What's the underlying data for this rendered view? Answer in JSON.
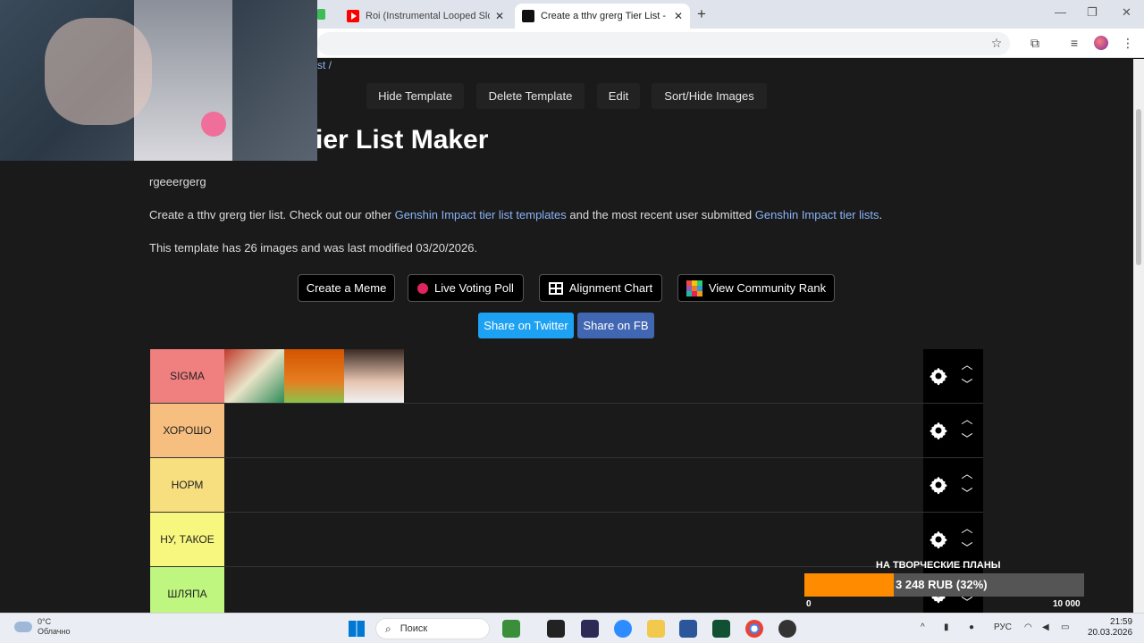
{
  "browser": {
    "tabs": [
      {
        "title": "Roi (Instrumental Looped Slowe",
        "active": false
      },
      {
        "title": "Create a tthv grerg Tier List - Ti",
        "active": true
      }
    ],
    "new_tab": "+",
    "window_controls": [
      "—",
      "❐",
      "✕"
    ]
  },
  "page": {
    "breadcrumb_tail": "st /",
    "top_buttons": [
      "Hide Template",
      "Delete Template",
      "Edit",
      "Sort/Hide Images"
    ],
    "title": "ier List Maker",
    "subtitle": "rgeeergerg",
    "description": {
      "part1": "Create a tthv grerg tier list. Check out our other ",
      "link1": "Genshin Impact tier list templates",
      "part2": " and the most recent user submitted ",
      "link2": "Genshin Impact tier lists",
      "part3": "."
    },
    "template_info": "This template has 26 images and was last modified 03/20/2026.",
    "action_buttons": [
      "Create a Meme",
      "Live Voting Poll",
      "Alignment Chart",
      "View Community Rank"
    ],
    "share_buttons": [
      "Share on Twitter",
      "Share on FB"
    ]
  },
  "tiers": [
    {
      "label": "SIGMA",
      "color": "#f07f7f",
      "items": 3
    },
    {
      "label": "ХОРОШО",
      "color": "#f6bf7f",
      "items": 0
    },
    {
      "label": "НОРМ",
      "color": "#f7df7f",
      "items": 0
    },
    {
      "label": "НУ, ТАКОЕ",
      "color": "#f7f67f",
      "items": 0
    },
    {
      "label": "ШЛЯПА",
      "color": "#bff67f",
      "items": 0
    }
  ],
  "donation": {
    "title": "НА ТВОРЧЕСКИЕ ПЛАНЫ",
    "amount_text": "3 248 RUB (32%)",
    "progress": 0.32,
    "min": "0",
    "max": "10 000"
  },
  "taskbar": {
    "weather_temp": "0°C",
    "weather_desc": "Облачно",
    "search_placeholder": "Поиск",
    "lang": "РУС",
    "time": "21:59",
    "date": "20.03.2026"
  }
}
